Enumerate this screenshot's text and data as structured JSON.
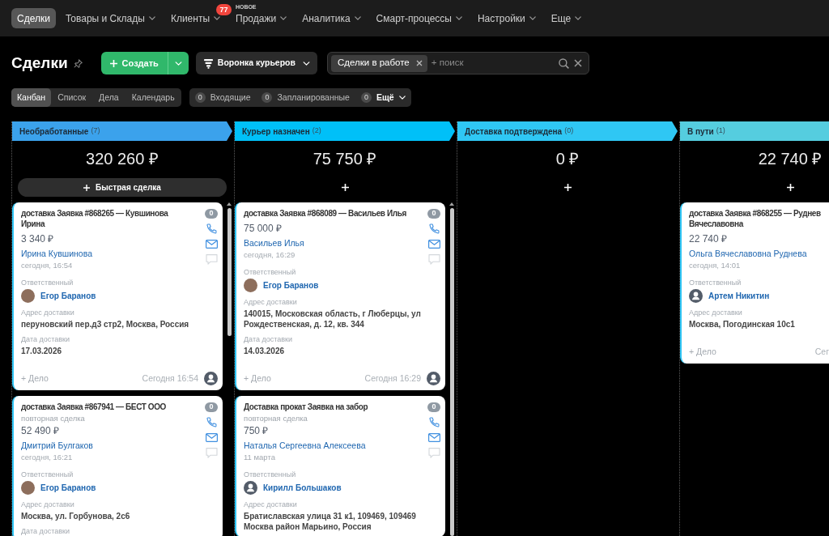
{
  "nav": {
    "items": [
      {
        "label": "Сделки",
        "selected": true,
        "menu": false
      },
      {
        "label": "Товары и Склады",
        "selected": false,
        "menu": true
      },
      {
        "label": "Клиенты",
        "selected": false,
        "menu": true,
        "badge": "77"
      },
      {
        "label": "Продажи",
        "selected": false,
        "menu": true,
        "tag": "НОВОЕ"
      },
      {
        "label": "Аналитика",
        "selected": false,
        "menu": true
      },
      {
        "label": "Смарт-процессы",
        "selected": false,
        "menu": true
      },
      {
        "label": "Настройки",
        "selected": false,
        "menu": true
      },
      {
        "label": "Еще",
        "selected": false,
        "menu": true
      }
    ]
  },
  "header": {
    "title": "Сделки",
    "create_button": "Создать",
    "funnel_button": "Воронка курьеров",
    "search": {
      "chips": [
        {
          "label": "Сделки в работе"
        }
      ],
      "placeholder": "+ поиск"
    }
  },
  "views": [
    {
      "label": "Канбан",
      "selected": true
    },
    {
      "label": "Список",
      "selected": false
    },
    {
      "label": "Дела",
      "selected": false
    },
    {
      "label": "Календарь",
      "selected": false
    }
  ],
  "counters": [
    {
      "kind": "filter",
      "count": "0",
      "label": "Входящие"
    },
    {
      "kind": "filter",
      "count": "0",
      "label": "Запланированные"
    },
    {
      "kind": "menu",
      "count": "0",
      "label": "Ещё"
    }
  ],
  "columns": [
    {
      "title": "Необработанные",
      "count": "(7)",
      "color": "#3ba2ec",
      "total": "320 260 ₽",
      "add": {
        "kind": "quick",
        "label": "Быстрая сделка"
      },
      "cards": [
        {
          "title": "доставка Заявка #868265 — Кувшинова Ирина",
          "amount": "3 340 ₽",
          "contact": "Ирина Кувшинова",
          "created": "сегодня, 16:54",
          "fields": [
            {
              "kind": "person",
              "label": "Ответственный",
              "value": "Егор Баранов",
              "photo": true
            },
            {
              "kind": "text",
              "label": "Адрес доставки",
              "value": "перуновский пер.д3 стр2, Москва, Россия"
            },
            {
              "kind": "text",
              "label": "Дата доставки",
              "value": "17.03.2026"
            }
          ],
          "activity_count": "0",
          "add_activity": "+ Дело",
          "updated": "Сегодня 16:54"
        },
        {
          "title": "доставка Заявка #867941 — БЕСТ ООО",
          "note": "повторная сделка",
          "amount": "52 490 ₽",
          "contact": "Дмитрий Булгаков",
          "created": "сегодня, 16:21",
          "fields": [
            {
              "kind": "person",
              "label": "Ответственный",
              "value": "Егор Баранов",
              "photo": true
            },
            {
              "kind": "text",
              "label": "Адрес доставки",
              "value": "Москва, ул. Горбунова, 2с6"
            },
            {
              "kind": "text",
              "label": "Дата доставки"
            }
          ],
          "activity_count": "0"
        }
      ]
    },
    {
      "title": "Курьер назначен",
      "count": "(2)",
      "color": "#00c0f8",
      "total": "75 750 ₽",
      "add": {
        "kind": "plus"
      },
      "cards": [
        {
          "title": "доставка Заявка #868089 — Васильев Илья",
          "amount": "75 000 ₽",
          "contact": "Васильев Илья",
          "created": "сегодня, 16:29",
          "fields": [
            {
              "kind": "person",
              "label": "Ответственный",
              "value": "Егор Баранов",
              "photo": true
            },
            {
              "kind": "text",
              "label": "Адрес доставки",
              "value": "140015, Московская область, г Люберцы, ул Рождественская, д. 12, кв. 344"
            },
            {
              "kind": "text",
              "label": "Дата доставки",
              "value": "14.03.2026"
            }
          ],
          "activity_count": "0",
          "add_activity": "+ Дело",
          "updated": "Сегодня 16:29"
        },
        {
          "title": "Доставка прокат Заявка на забор",
          "note": "повторная сделка",
          "amount": "750 ₽",
          "contact": "Наталья Сергеевна Алексеева",
          "created": "11 марта",
          "fields": [
            {
              "kind": "person",
              "label": "Ответственный",
              "value": "Кирилл Большаков",
              "photo": false
            },
            {
              "kind": "text",
              "label": "Адрес доставки",
              "value": "Братиславская улица 31 к1, 109469, 109469 Москва район Марьино, Россия"
            }
          ],
          "activity_count": "0"
        }
      ]
    },
    {
      "title": "Доставка подтверждена",
      "count": "(0)",
      "color": "#2fc7f4",
      "total": "0 ₽",
      "add": {
        "kind": "plus"
      }
    },
    {
      "title": "В пути",
      "count": "(1)",
      "color": "#55cddf",
      "total": "22 740 ₽",
      "add": {
        "kind": "plus"
      },
      "cards": [
        {
          "title": "доставка Заявка #868255 — Руднев Вячеславовна",
          "amount": "22 740 ₽",
          "contact": "Ольга Вячеславовна Руднева",
          "created": "сегодня, 14:01",
          "fields": [
            {
              "kind": "person",
              "label": "Ответственный",
              "value": "Артем Никитин",
              "photo": false
            },
            {
              "kind": "text",
              "label": "Адрес доставки",
              "value": "Москва, Погодинская 10с1"
            }
          ],
          "add_activity": "+ Дело",
          "updated": "Сег"
        }
      ]
    }
  ]
}
